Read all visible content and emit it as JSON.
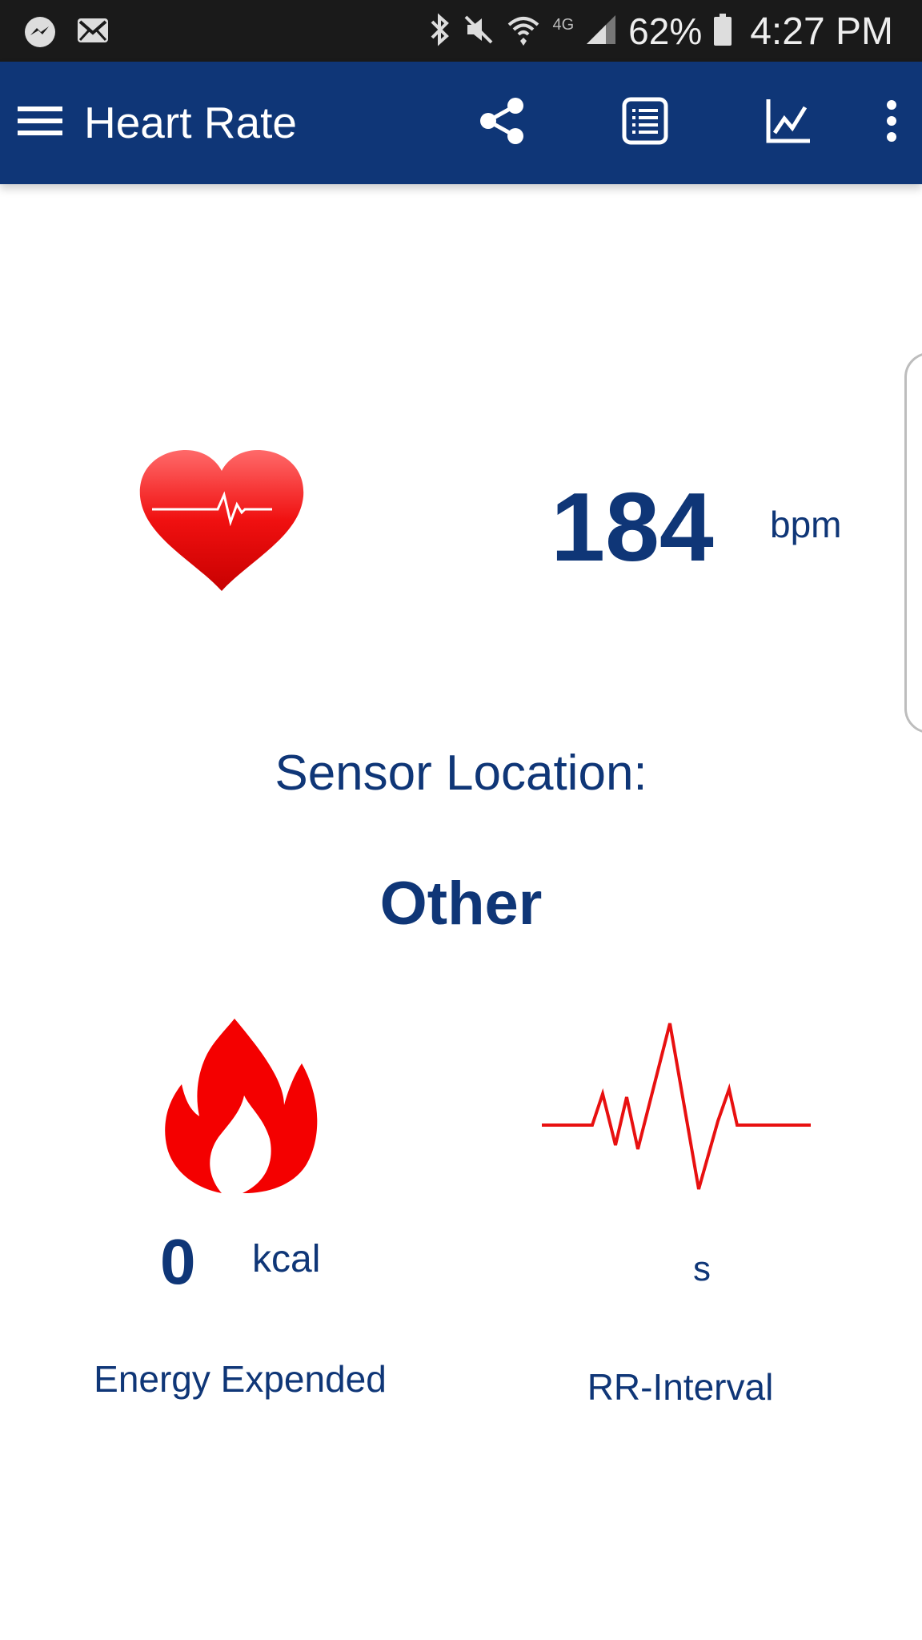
{
  "status_bar": {
    "battery_percent": "62%",
    "time": "4:27 PM",
    "network": "4G",
    "left_icons": [
      "messenger-icon",
      "mail-icon"
    ],
    "right_icons": [
      "bluetooth-icon",
      "mute-icon",
      "wifi-icon",
      "signal-icon",
      "battery-icon"
    ]
  },
  "app_bar": {
    "title": "Heart Rate",
    "icons": [
      "menu-icon",
      "share-icon",
      "list-icon",
      "chart-icon",
      "more-icon"
    ]
  },
  "heart_rate": {
    "value": "184",
    "unit": "bpm",
    "icon": "heart-icon"
  },
  "sensor": {
    "label": "Sensor Location:",
    "value": "Other"
  },
  "energy": {
    "value": "0",
    "unit": "kcal",
    "label": "Energy Expended",
    "icon": "flame-icon"
  },
  "rr_interval": {
    "value": "",
    "unit": "s",
    "label": "RR-Interval",
    "icon": "ecg-wave-icon"
  },
  "colors": {
    "primary": "#0f3677",
    "accent_red": "#ff0000",
    "status_bar": "#1a1a1a"
  }
}
